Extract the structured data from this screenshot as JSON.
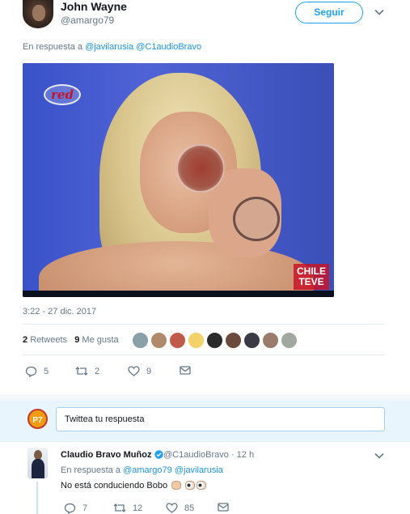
{
  "tweet": {
    "author_name": "John Wayne",
    "author_handle": "@amargo79",
    "follow_label": "Seguir",
    "reply_prefix": "En respuesta a",
    "reply_mentions": [
      "@javilarusia",
      "@C1audioBravo"
    ],
    "media": {
      "logo_left": "red",
      "logo_right_line1": "CHILE",
      "logo_right_line2": "TEVE"
    },
    "timestamp": "3:22 - 27 dic. 2017",
    "stats": {
      "retweets_count": "2",
      "retweets_label": "Retweets",
      "likes_count": "9",
      "likes_label": "Me gusta"
    },
    "actions": {
      "replies": "5",
      "retweets": "2",
      "likes": "9"
    }
  },
  "reply_box": {
    "avatar_text": "P7",
    "placeholder": "Twittea tu respuesta"
  },
  "reply_tweet": {
    "author_name": "Claudio Bravo Muñoz",
    "author_handle": "@C1audioBravo",
    "time": "· 12 h",
    "reply_prefix": "En respuesta a",
    "reply_mentions": [
      "@amargo79",
      "@javilarusia"
    ],
    "text": "No está conduciendo Bobo",
    "actions": {
      "replies": "7",
      "retweets": "12",
      "likes": "85"
    }
  },
  "colors": {
    "accent": "#1da1f2",
    "link": "#1b95e0",
    "muted": "#657786",
    "reply_bg": "#e8f5fd"
  }
}
